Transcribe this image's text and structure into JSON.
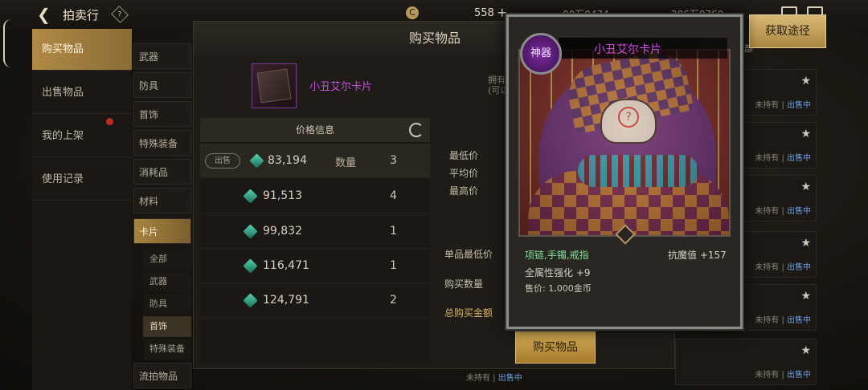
{
  "topbar": {
    "title": "拍卖行",
    "help": "?",
    "currency_symbol": "C",
    "currency_value": "558",
    "plus": "+",
    "currency2": "00万0474",
    "currency3": "286万0769"
  },
  "leftnav": {
    "items": [
      {
        "label": "购买物品"
      },
      {
        "label": "出售物品"
      },
      {
        "label": "我的上架"
      },
      {
        "label": "使用记录"
      }
    ]
  },
  "categories": {
    "items": [
      {
        "label": "武器"
      },
      {
        "label": "防具"
      },
      {
        "label": "首饰"
      },
      {
        "label": "特殊装备"
      },
      {
        "label": "消耗品"
      },
      {
        "label": "材料"
      },
      {
        "label": "卡片"
      }
    ],
    "sub": [
      {
        "label": "全部"
      },
      {
        "label": "武器"
      },
      {
        "label": "防具"
      },
      {
        "label": "首饰"
      },
      {
        "label": "特殊装备"
      }
    ],
    "bottom": "流拍物品"
  },
  "right": {
    "get_route": "获取途径",
    "status_not_owned": "未持有",
    "status_sep": " | ",
    "status_selling": "出售中",
    "partial": "部"
  },
  "modal": {
    "title": "购买物品",
    "item_name": "小丑艾尔卡片",
    "owned_line1": "拥有",
    "owned_line2": "(可以",
    "price_header": "价格信息",
    "sell_tag": "出售",
    "qty_label": "数量",
    "rows": [
      {
        "price": "83,194",
        "qty": "3"
      },
      {
        "price": "91,513",
        "qty": "4"
      },
      {
        "price": "99,832",
        "qty": "1"
      },
      {
        "price": "116,471",
        "qty": "1"
      },
      {
        "price": "124,791",
        "qty": "2"
      }
    ],
    "stats": {
      "min": "最低价",
      "avg": "平均价",
      "max": "最高价"
    },
    "unit_min": "单品最低价",
    "buy_qty": "购买数量",
    "total": "总购买金额",
    "buy_button": "购买物品"
  },
  "card": {
    "badge": "神器",
    "title": "小丑艾尔卡片",
    "slots": "项链,手镯,戒指",
    "resist": "抗魔值 +157",
    "allstat": "全属性强化 +9",
    "price": "售价: 1,000金币",
    "art_symbol": "?"
  }
}
